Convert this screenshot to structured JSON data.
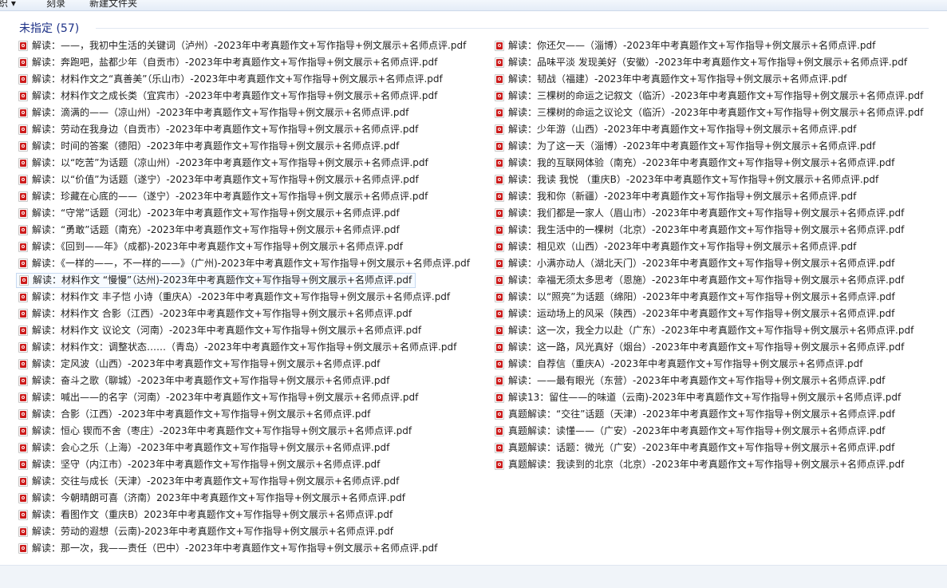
{
  "toolbar": {
    "organize": "组织 ▾",
    "share": "刻录",
    "new_folder": "新建文件夹"
  },
  "group": {
    "title": "未指定 (57)"
  },
  "files_left": [
    "解读：——，我初中生活的关键词（泸州）-2023年中考真题作文+写作指导+例文展示+名师点评.pdf",
    "解读：奔跑吧，盐都少年（自贡市）-2023年中考真题作文+写作指导+例文展示+名师点评.pdf",
    "解读：材料作文之“真善美”（乐山市）-2023年中考真题作文+写作指导+例文展示+名师点评.pdf",
    "解读：材料作文之成长类（宜宾市）-2023年中考真题作文+写作指导+例文展示+名师点评.pdf",
    "解读：滴满的——（凉山州）-2023年中考真题作文+写作指导+例文展示+名师点评.pdf",
    "解读：劳动在我身边（自贡市）-2023年中考真题作文+写作指导+例文展示+名师点评.pdf",
    "解读：时间的答案（德阳）-2023年中考真题作文+写作指导+例文展示+名师点评.pdf",
    "解读：以“吃苦”为话题（凉山州）-2023年中考真题作文+写作指导+例文展示+名师点评.pdf",
    "解读：以“价值”为话题（遂宁）-2023年中考真题作文+写作指导+例文展示+名师点评.pdf",
    "解读：珍藏在心底的——（遂宁）-2023年中考真题作文+写作指导+例文展示+名师点评.pdf",
    "解读：“守常”话题（河北）-2023年中考真题作文+写作指导+例文展示+名师点评.pdf",
    "解读：“勇敢”话题（南充）-2023年中考真题作文+写作指导+例文展示+名师点评.pdf",
    "解读：《回到——年》（成都)-2023年中考真题作文+写作指导+例文展示+名师点评.pdf",
    "解读：《一样的——，不一样的——》（广州)-2023年中考真题作文+写作指导+例文展示+名师点评.pdf",
    "解读：材料作文 “慢慢”（达州)-2023年中考真题作文+写作指导+例文展示+名师点评.pdf",
    "解读：材料作文 丰子恺 小诗（重庆A）-2023年中考真题作文+写作指导+例文展示+名师点评.pdf",
    "解读：材料作文 合影（江西）-2023年中考真题作文+写作指导+例文展示+名师点评.pdf",
    "解读：材料作文 议论文（河南）-2023年中考真题作文+写作指导+例文展示+名师点评.pdf",
    "解读：材料作文：调整状态……（青岛）-2023年中考真题作文+写作指导+例文展示+名师点评.pdf",
    "解读：定风波（山西）-2023年中考真题作文+写作指导+例文展示+名师点评.pdf",
    "解读：奋斗之歌（聊城）-2023年中考真题作文+写作指导+例文展示+名师点评.pdf",
    "解读：喊出——的名字（河南）-2023年中考真题作文+写作指导+例文展示+名师点评.pdf",
    "解读：合影（江西）-2023年中考真题作文+写作指导+例文展示+名师点评.pdf",
    "解读：恒心 锲而不舍（枣庄）-2023年中考真题作文+写作指导+例文展示+名师点评.pdf",
    "解读：会心之乐（上海）-2023年中考真题作文+写作指导+例文展示+名师点评.pdf",
    "解读：坚守（内江市）-2023年中考真题作文+写作指导+例文展示+名师点评.pdf",
    "解读：交往与成长（天津）-2023年中考真题作文+写作指导+例文展示+名师点评.pdf",
    "解读：今朝晴朗可喜（济南）2023年中考真题作文+写作指导+例文展示+名师点评.pdf",
    "解读：看图作文（重庆B）2023年中考真题作文+写作指导+例文展示+名师点评.pdf",
    "解读：劳动的遐想（云南)-2023年中考真题作文+写作指导+例文展示+名师点评.pdf",
    "解读：那一次，我——责任（巴中）-2023年中考真题作文+写作指导+例文展示+名师点评.pdf"
  ],
  "files_right": [
    "解读：你还欠——（淄博）-2023年中考真题作文+写作指导+例文展示+名师点评.pdf",
    "解读：品味平淡 发现美好（安徽）-2023年中考真题作文+写作指导+例文展示+名师点评.pdf",
    "解读：韧战（福建）-2023年中考真题作文+写作指导+例文展示+名师点评.pdf",
    "解读：三棵树的命运之记叙文（临沂）-2023年中考真题作文+写作指导+例文展示+名师点评.pdf",
    "解读：三棵树的命运之议论文（临沂）-2023年中考真题作文+写作指导+例文展示+名师点评.pdf",
    "解读：少年游（山西）-2023年中考真题作文+写作指导+例文展示+名师点评.pdf",
    "解读：为了这一天（淄博）-2023年中考真题作文+写作指导+例文展示+名师点评.pdf",
    "解读：我的互联网体验（南充）-2023年中考真题作文+写作指导+例文展示+名师点评.pdf",
    "解读：我读 我悦 （重庆B）-2023年中考真题作文+写作指导+例文展示+名师点评.pdf",
    "解读：我和你（新疆）-2023年中考真题作文+写作指导+例文展示+名师点评.pdf",
    "解读：我们都是一家人（眉山市）-2023年中考真题作文+写作指导+例文展示+名师点评.pdf",
    "解读：我生活中的一棵树（北京）-2023年中考真题作文+写作指导+例文展示+名师点评.pdf",
    "解读：相见欢（山西）-2023年中考真题作文+写作指导+例文展示+名师点评.pdf",
    "解读：小满亦动人（湖北天门）-2023年中考真题作文+写作指导+例文展示+名师点评.pdf",
    "解读：幸福无须太多思考（恩施）-2023年中考真题作文+写作指导+例文展示+名师点评.pdf",
    "解读：以“照亮”为话题（绵阳）-2023年中考真题作文+写作指导+例文展示+名师点评.pdf",
    "解读：运动场上的风采（陕西）-2023年中考真题作文+写作指导+例文展示+名师点评.pdf",
    "解读：这一次，我全力以赴（广东）-2023年中考真题作文+写作指导+例文展示+名师点评.pdf",
    "解读：这一路，风光真好（烟台）-2023年中考真题作文+写作指导+例文展示+名师点评.pdf",
    "解读：自荐信（重庆A）-2023年中考真题作文+写作指导+例文展示+名师点评.pdf",
    "解读：——最有眼光（东营）-2023年中考真题作文+写作指导+例文展示+名师点评.pdf",
    "解读13：留住——的味道（云南)-2023年中考真题作文+写作指导+例文展示+名师点评.pdf",
    "真题解读：“交往”话题（天津）-2023年中考真题作文+写作指导+例文展示+名师点评.pdf",
    "真题解读：读懂——（广安）-2023年中考真题作文+写作指导+例文展示+名师点评.pdf",
    "真题解读：话题：微光（广安）-2023年中考真题作文+写作指导+例文展示+名师点评.pdf",
    "真题解读：我读到的北京（北京）-2023年中考真题作文+写作指导+例文展示+名师点评.pdf"
  ],
  "selected_left_index": 14,
  "colors": {
    "group_title": "#1e3287",
    "selection_border": "#c6d9f1",
    "pdf_icon_red": "#cc1b1b"
  },
  "icons": {
    "file": "pdf-file-icon"
  }
}
